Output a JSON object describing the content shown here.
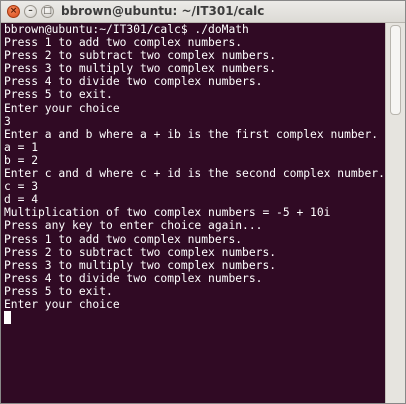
{
  "window": {
    "title": "bbrown@ubuntu: ~/IT301/calc",
    "close_glyph": "×",
    "minimize_glyph": "–",
    "maximize_glyph": "□"
  },
  "terminal": {
    "lines": [
      "bbrown@ubuntu:~/IT301/calc$ ./doMath",
      "Press 1 to add two complex numbers.",
      "Press 2 to subtract two complex numbers.",
      "Press 3 to multiply two complex numbers.",
      "Press 4 to divide two complex numbers.",
      "Press 5 to exit.",
      "Enter your choice",
      "3",
      "Enter a and b where a + ib is the first complex number.",
      "a = 1",
      "b = 2",
      "Enter c and d where c + id is the second complex number.",
      "c = 3",
      "d = 4",
      "Multiplication of two complex numbers = -5 + 10i",
      "Press any key to enter choice again...",
      "Press 1 to add two complex numbers.",
      "Press 2 to subtract two complex numbers.",
      "Press 3 to multiply two complex numbers.",
      "Press 4 to divide two complex numbers.",
      "Press 5 to exit.",
      "Enter your choice"
    ]
  },
  "colors": {
    "terminal_background": "#300a24",
    "terminal_foreground": "#ffffff",
    "close_button": "#e2571e"
  }
}
